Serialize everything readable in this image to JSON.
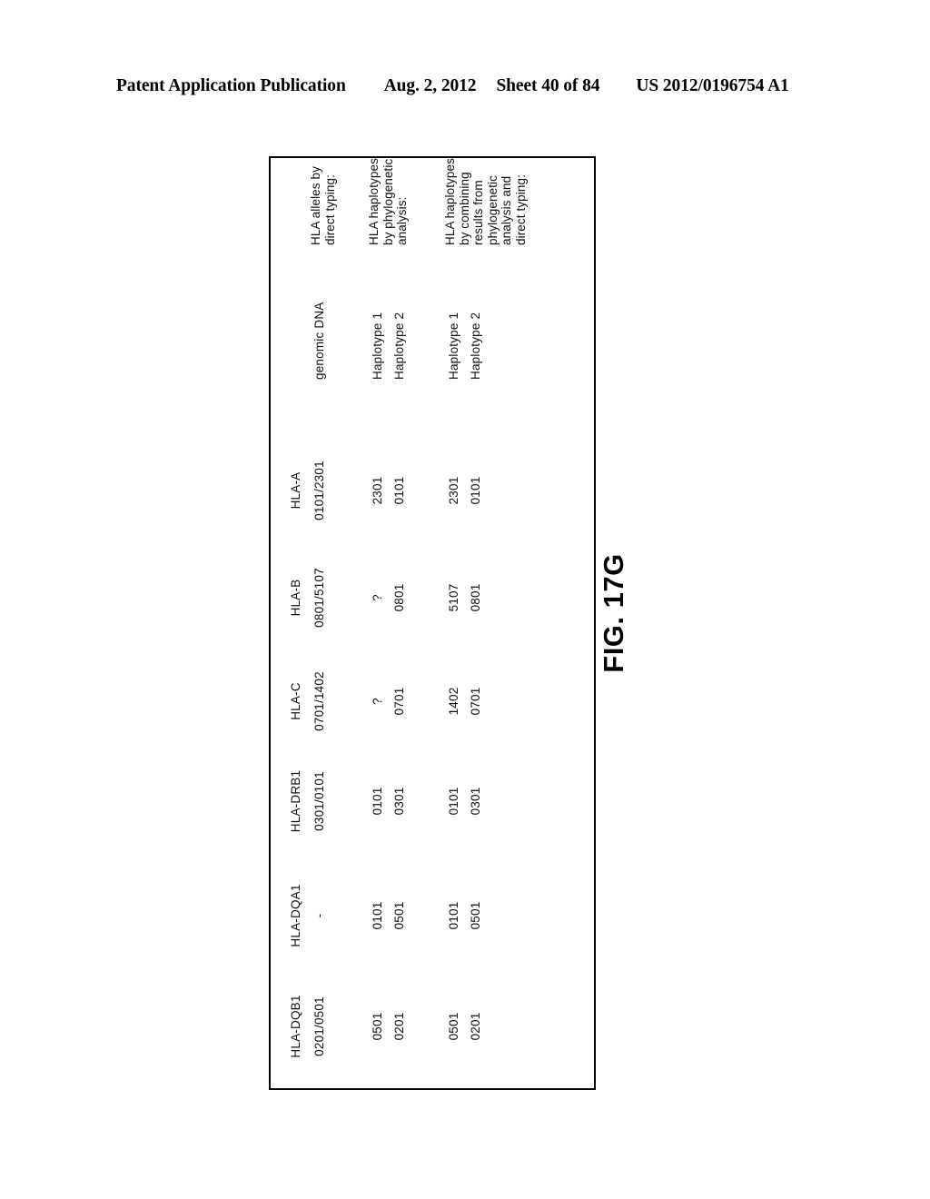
{
  "header": {
    "publication_label": "Patent Application Publication",
    "date": "Aug. 2, 2012",
    "sheet": "Sheet 40 of 84",
    "patent_number": "US 2012/0196754 A1"
  },
  "figure": {
    "caption": "FIG. 17G"
  },
  "table": {
    "columns": [
      {
        "header": "HLA-A"
      },
      {
        "header": "HLA-B"
      },
      {
        "header": "HLA-C"
      },
      {
        "header": "HLA-DRB1"
      },
      {
        "header": "HLA-DQA1"
      },
      {
        "header": "HLA-DQB1"
      }
    ],
    "groups": [
      {
        "label": "HLA alleles by\ndirect typing:",
        "rows": [
          {
            "label": "genomic DNA",
            "values": [
              "0101/2301",
              "0801/5107",
              "0701/1402",
              "0301/0101",
              "-",
              "0201/0501"
            ]
          }
        ]
      },
      {
        "label": "HLA haplotypes\nby phylogenetic\nanalysis:",
        "rows": [
          {
            "label": "Haplotype 1",
            "values": [
              "2301",
              "?",
              "?",
              "0101",
              "0101",
              "0501"
            ]
          },
          {
            "label": "Haplotype 2",
            "values": [
              "0101",
              "0801",
              "0701",
              "0301",
              "0501",
              "0201"
            ]
          }
        ]
      },
      {
        "label": "HLA haplotypes\nby combining\nresults from\nphylogenetic\nanalysis and\ndirect typing:",
        "rows": [
          {
            "label": "Haplotype 1",
            "values": [
              "2301",
              "5107",
              "1402",
              "0101",
              "0101",
              "0501"
            ]
          },
          {
            "label": "Haplotype 2",
            "values": [
              "0101",
              "0801",
              "0701",
              "0301",
              "0501",
              "0201"
            ]
          }
        ]
      }
    ]
  }
}
